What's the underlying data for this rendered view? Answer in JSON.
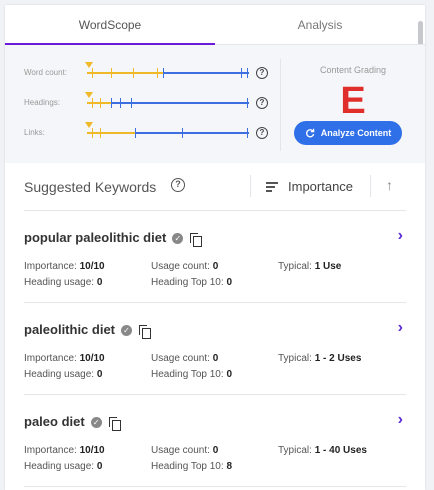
{
  "tabs": [
    {
      "label": "WordScope",
      "active": true
    },
    {
      "label": "Analysis",
      "active": false
    }
  ],
  "metrics": [
    {
      "label": "Word count:"
    },
    {
      "label": "Headings:"
    },
    {
      "label": "Links:"
    }
  ],
  "grading": {
    "title": "Content Grading",
    "grade": "E",
    "grade_color": "#e02f2a",
    "button_label": "Analyze Content"
  },
  "keywords_header": {
    "title": "Suggested Keywords",
    "sort_label": "Importance"
  },
  "keywords": [
    {
      "name": "popular paleolithic diet",
      "importance_label": "Importance:",
      "importance": "10/10",
      "usage_label": "Usage count:",
      "usage": "0",
      "typical_label": "Typical:",
      "typical": "1 Use",
      "heading_usage_label": "Heading usage:",
      "heading_usage": "0",
      "heading_top_label": "Heading Top 10:",
      "heading_top": "0"
    },
    {
      "name": "paleolithic diet",
      "importance_label": "Importance:",
      "importance": "10/10",
      "usage_label": "Usage count:",
      "usage": "0",
      "typical_label": "Typical:",
      "typical": "1 - 2 Uses",
      "heading_usage_label": "Heading usage:",
      "heading_usage": "0",
      "heading_top_label": "Heading Top 10:",
      "heading_top": "0"
    },
    {
      "name": "paleo diet",
      "importance_label": "Importance:",
      "importance": "10/10",
      "usage_label": "Usage count:",
      "usage": "0",
      "typical_label": "Typical:",
      "typical": "1 - 40 Uses",
      "heading_usage_label": "Heading usage:",
      "heading_usage": "0",
      "heading_top_label": "Heading Top 10:",
      "heading_top": "8"
    }
  ],
  "colors": {
    "accent": "#6a1bd8",
    "button": "#2f6fe8",
    "yellow": "#f0b928",
    "blue": "#3d6fe0"
  }
}
